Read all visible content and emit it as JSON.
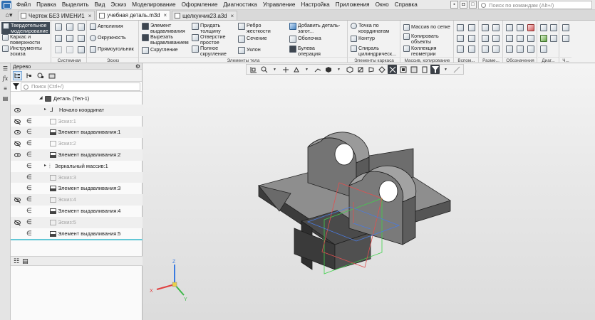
{
  "menu": {
    "items": [
      "Файл",
      "Правка",
      "Выделить",
      "Вид",
      "Эскиз",
      "Моделирование",
      "Оформление",
      "Диагностика",
      "Управление",
      "Настройка",
      "Приложения",
      "Окно",
      "Справка"
    ],
    "search_placeholder": "Поиск по командам (Alt+/)"
  },
  "tabs": [
    {
      "label": "Чертеж БЕЗ ИМЕНИ1",
      "active": false
    },
    {
      "label": "учебная деталь.m3d",
      "active": true
    },
    {
      "label": "щелкунчик23.a3d",
      "active": false
    }
  ],
  "ribbon": {
    "modes": [
      "Твердотельное моделирование",
      "Каркас и поверхности",
      "Инструменты эскиза"
    ],
    "system_group": {
      "label": "Системная"
    },
    "sketch_group": {
      "label": "Эскиз",
      "buttons": [
        "Автолиния",
        "Окружность",
        "Прямоугольник"
      ]
    },
    "body_group": {
      "label": "Элементы тела",
      "buttons": [
        "Элемент выдавливания",
        "Вырезать выдавливанием",
        "Скругление",
        "Придать толщину",
        "Отверстие простое",
        "Полное скругление",
        "Ребро жесткости",
        "Сечение",
        "Уклон",
        "Добавить деталь-загот...",
        "Оболочка",
        "Булева операция"
      ]
    },
    "frame_group": {
      "label": "Элементы каркаса",
      "buttons": [
        "Точка по координатам",
        "Контур",
        "Спираль цилиндрическ..."
      ]
    },
    "array_group": {
      "label": "Массив, копирование",
      "buttons": [
        "Массив по сетке",
        "Копировать объекты",
        "Коллекция геометрии"
      ]
    },
    "short_groups": [
      "Вспом...",
      "Разме...",
      "Обозначения",
      "Диаг...",
      "Ч..."
    ]
  },
  "tree": {
    "title": "Дерево",
    "search_placeholder": "Поиск (Ctrl+/)",
    "root": "Деталь (Тел-1)",
    "origin": "Начало координат",
    "nodes": [
      {
        "label": "Эскиз:1",
        "kind": "sketch"
      },
      {
        "label": "Элемент выдавливания:1",
        "kind": "extrude"
      },
      {
        "label": "Эскиз:2",
        "kind": "sketch"
      },
      {
        "label": "Элемент выдавливания:2",
        "kind": "extrude"
      },
      {
        "label": "Зеркальный массив:1",
        "kind": "mirror"
      },
      {
        "label": "Эскиз:3",
        "kind": "sketch"
      },
      {
        "label": "Элемент выдавливания:3",
        "kind": "extrude"
      },
      {
        "label": "Эскиз:4",
        "kind": "sketch"
      },
      {
        "label": "Элемент выдавливания:4",
        "kind": "extrude"
      },
      {
        "label": "Эскиз:5",
        "kind": "sketch"
      },
      {
        "label": "Элемент выдавливания:5",
        "kind": "extrude"
      }
    ]
  },
  "triad": {
    "x": "X",
    "y": "Y",
    "z": "Z"
  },
  "colors": {
    "accent": "#62c7d6",
    "brand": "#2f6fb3"
  }
}
